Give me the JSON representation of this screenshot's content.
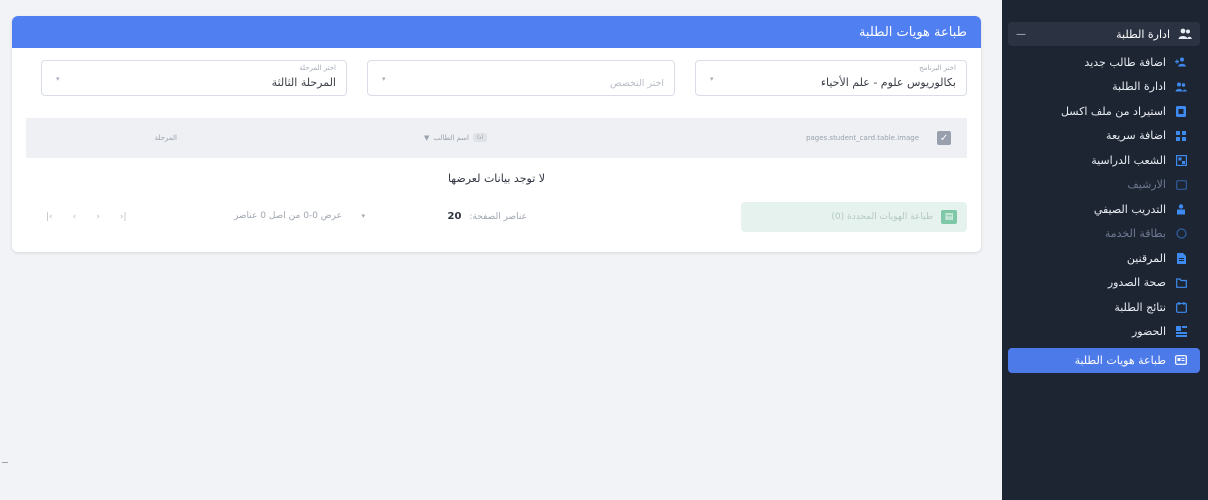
{
  "sidebar": {
    "group_label": "ادارة الطلبة",
    "items": [
      {
        "label": "اضافة طالب جديد",
        "icon": "add-user-icon",
        "muted": false
      },
      {
        "label": "ادارة الطلبة",
        "icon": "users-icon",
        "muted": false
      },
      {
        "label": "استيراد من ملف اكسل",
        "icon": "excel-icon",
        "muted": false
      },
      {
        "label": "اضافة سريعة",
        "icon": "grid-add-icon",
        "muted": false
      },
      {
        "label": "الشعب الدراسية",
        "icon": "sections-icon",
        "muted": false
      },
      {
        "label": "الارشيف",
        "icon": "archive-icon",
        "muted": true
      },
      {
        "label": "التدريب الصيفي",
        "icon": "training-icon",
        "muted": false
      },
      {
        "label": "بطاقة الخدمة",
        "icon": "card-icon",
        "muted": true
      },
      {
        "label": "المرقنين",
        "icon": "document-icon",
        "muted": false
      },
      {
        "label": "صحة الصدور",
        "icon": "folder-icon",
        "muted": false
      },
      {
        "label": "نتائج الطلبة",
        "icon": "results-icon",
        "muted": false
      },
      {
        "label": "الحضور",
        "icon": "attendance-icon",
        "muted": false
      },
      {
        "label": "طباعة هويات الطلبة",
        "icon": "id-card-icon",
        "muted": false,
        "active": true
      }
    ]
  },
  "page": {
    "title": "طباعة هويات الطلبة"
  },
  "filters": {
    "program": {
      "label": "اختر البرنامج",
      "value": "بكالوريوس علوم - علم الأحياء"
    },
    "specialization": {
      "label": "",
      "placeholder": "اختر التخصص"
    },
    "stage": {
      "label": "اختر المرحلة",
      "value": "المرحلة الثالثة"
    }
  },
  "table": {
    "headers": [
      "pages.student_card.table.image",
      "اسم الطالب",
      "المرحلة"
    ],
    "sort_badge": "اذا",
    "empty_text": "لا توجد بيانات لعرضها"
  },
  "pager": {
    "print_button": "طباعة الهويات المحددة (0)",
    "items_per_page_label": "عناصر الصفحة:",
    "items_per_page_value": "20",
    "range_text": "عرض 0-0 من اصل 0 عناصر",
    "nav_icons": [
      "first-page-icon",
      "prev-page-icon",
      "next-page-icon",
      "last-page-icon"
    ]
  },
  "colors": {
    "header_blue": "#4f7ff0",
    "sidebar_bg": "#1e2532",
    "active_item": "#4c7ae8"
  }
}
